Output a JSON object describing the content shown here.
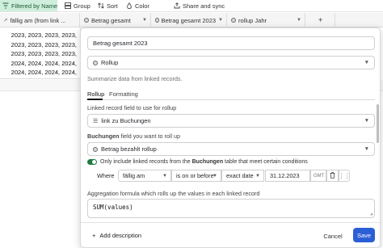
{
  "toolbar": {
    "filter_label": "Filtered by Name",
    "group_label": "Group",
    "sort_label": "Sort",
    "color_label": "Color",
    "share_label": "Share and sync"
  },
  "columns": [
    {
      "label": "fällig am (from link ..."
    },
    {
      "label": "Betrag gesamt"
    },
    {
      "label": "Betrag gesamt 2023"
    },
    {
      "label": "rollup Jahr"
    }
  ],
  "years_lines": [
    "2023, 2023, 2023, 2023,",
    "2023, 2023, 2023, 2023,",
    "2023, 2023, 2023, 2023,",
    "2024, 2024, 2024, 2024,",
    "2024, 2024, 2024, 2024,",
    "2024, 2024, 2024"
  ],
  "panel": {
    "field_name": "Betrag gesamt 2023",
    "field_type": "Rollup",
    "type_hint": "Summarize data from linked records.",
    "tabs": [
      "Rollup",
      "Formatting"
    ],
    "linked_label": "Linked record field to use for rollup",
    "linked_value": "link zu Buchungen",
    "rollup_label_field": "Buchungen",
    "rollup_label_rest": " field you want to roll up",
    "rollup_value": "Betrag bezahlt rollup",
    "toggle_pre": "Only include linked records from the ",
    "toggle_table": "Buchungen",
    "toggle_post": " table that meet certain conditions",
    "condition": {
      "where": "Where",
      "field": "fällig am",
      "operator": "is on or before",
      "mode": "exact date",
      "date": "31.12.2023",
      "tz": "GMT"
    },
    "agg_label": "Aggregation formula which rolls up the values in each linked record",
    "formula": "SUM(values)",
    "add_description": "Add description",
    "cancel": "Cancel",
    "save": "Save"
  }
}
